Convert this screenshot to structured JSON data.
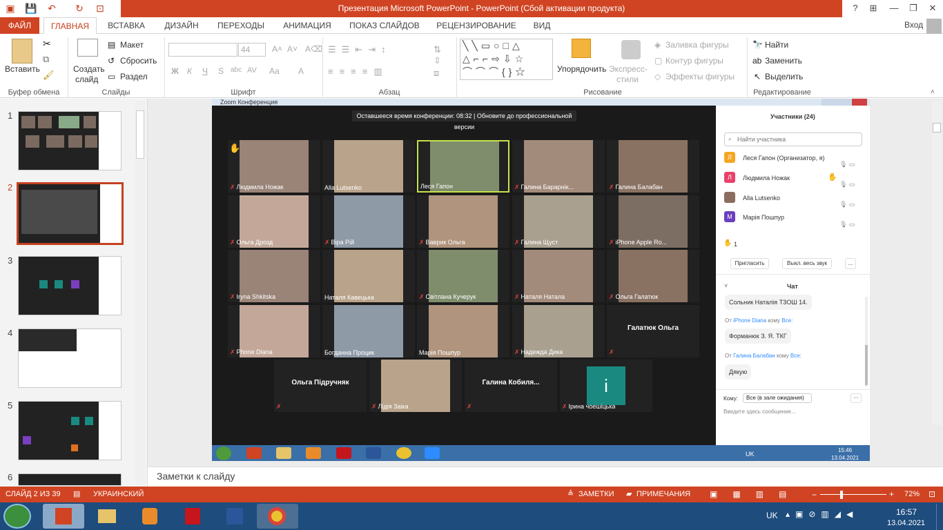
{
  "window": {
    "title": "Презентация Microsoft PowerPoint - PowerPoint (Сбой активации продукта)",
    "login": "Вход"
  },
  "tabs": [
    {
      "label": "ФАЙЛ"
    },
    {
      "label": "ГЛАВНАЯ"
    },
    {
      "label": "ВСТАВКА"
    },
    {
      "label": "ДИЗАЙН"
    },
    {
      "label": "ПЕРЕХОДЫ"
    },
    {
      "label": "АНИМАЦИЯ"
    },
    {
      "label": "ПОКАЗ СЛАЙДОВ"
    },
    {
      "label": "РЕЦЕНЗИРОВАНИЕ"
    },
    {
      "label": "ВИД"
    }
  ],
  "ribbon": {
    "clipboard": {
      "paste": "Вставить",
      "label": "Буфер обмена"
    },
    "slides": {
      "new_slide_1": "Создать",
      "new_slide_2": "слайд",
      "layout": "Макет",
      "reset": "Сбросить",
      "section": "Раздел",
      "label": "Слайды"
    },
    "font": {
      "size": "44",
      "bold": "Ж",
      "italic": "К",
      "underline": "Ч",
      "strike": "S",
      "label": "Шрифт"
    },
    "paragraph": {
      "label": "Абзац"
    },
    "drawing": {
      "arrange_1": "Упорядочить",
      "express_1": "Экспресс-",
      "express_2": "стили",
      "fill": "Заливка фигуры",
      "outline": "Контур фигуры",
      "effects": "Эффекты фигуры",
      "label": "Рисование"
    },
    "editing": {
      "find": "Найти",
      "replace": "Заменить",
      "select": "Выделить",
      "label": "Редактирование"
    }
  },
  "thumbs": [
    {
      "num": "1"
    },
    {
      "num": "2"
    },
    {
      "num": "3"
    },
    {
      "num": "4"
    },
    {
      "num": "5"
    },
    {
      "num": "6"
    }
  ],
  "zoom": {
    "window_title": "Zoom Конференция",
    "banner": "Оставшееся время конференции: 08:32 | Обновите до профессиональной версии",
    "tiles": [
      {
        "name": "Людмила Ножак",
        "mute": true,
        "hand": true
      },
      {
        "name": "Alla Lutsenko",
        "mute": false
      },
      {
        "name": "Леся Гапон",
        "mute": false,
        "active": true
      },
      {
        "name": "Галина Барарнік...",
        "mute": true
      },
      {
        "name": "Галина Балабан",
        "mute": true
      },
      {
        "name": "Ольга Дрозд",
        "mute": true
      },
      {
        "name": "Віра Рій",
        "mute": true
      },
      {
        "name": "Ваврик Ольга",
        "mute": true
      },
      {
        "name": "Галина Щуст",
        "mute": true
      },
      {
        "name": "iPhone Apple Ro...",
        "mute": true
      },
      {
        "name": "Iryna Shkitska",
        "mute": true
      },
      {
        "name": "Наталя Кавецька",
        "mute": false
      },
      {
        "name": "Світлана Кучерук",
        "mute": true
      },
      {
        "name": "Наталя Натала",
        "mute": true
      },
      {
        "name": "Ольга Галатюк",
        "mute": true
      },
      {
        "name": "Phone Diana",
        "mute": true
      },
      {
        "name": "Богданна Процик",
        "mute": false
      },
      {
        "name": "Марія Пошпур",
        "mute": false
      },
      {
        "name": "Надежда Дика",
        "mute": true
      },
      {
        "name": "",
        "big": "Галатюк Ольга",
        "mute": true,
        "nocam": true
      },
      {
        "name": "",
        "big": "Ольга Підручняк",
        "mute": true,
        "nocam": true
      },
      {
        "name": "Лідія Заіка",
        "mute": true
      },
      {
        "name": "",
        "big": "Галина  Кобиля...",
        "mute": true,
        "nocam": true
      },
      {
        "name": "Ірина чоешіцька",
        "mute": true,
        "letter": "i"
      }
    ],
    "participants": {
      "title": "Участники (24)",
      "search_placeholder": "Найти участника",
      "list": [
        {
          "letter": "Л",
          "name": "Леся Гапон (Организатор, я)",
          "color": "#f5a623"
        },
        {
          "letter": "Л",
          "name": "Людмила Ножак",
          "color": "#e8426a"
        },
        {
          "letter": "",
          "name": "Alla Lutsenko",
          "color": "#8a6d5e"
        },
        {
          "letter": "М",
          "name": "Марія Пошпур",
          "color": "#6b3fbf"
        }
      ],
      "hand_count": "1",
      "invite": "Пригласить",
      "mute_all": "Выкл. весь звук",
      "more": "..."
    },
    "chat": {
      "title": "Чат",
      "messages": [
        {
          "from": "",
          "text": "Сольник Наталія ТЗОШ 14."
        },
        {
          "from_pre": "От",
          "from": "iPhone Diana",
          "to_pre": "кому",
          "to": "Все:",
          "text": "Форманюк З. Я. ТКГ"
        },
        {
          "from_pre": "От",
          "from": "Галина Балабан",
          "to_pre": "кому",
          "to": "Все:",
          "text": "Дякую"
        }
      ],
      "to_label": "Кому:",
      "to_value": "Все (в зале ожидания)",
      "input_placeholder": "Введите здесь сообщение..."
    },
    "tray": {
      "lang": "UK",
      "time": "15:46",
      "date": "13.04.2021"
    }
  },
  "notes": "Заметки к слайду",
  "status": {
    "slide": "СЛАЙД 2 ИЗ 39",
    "lang": "УКРАИНСКИЙ",
    "notes": "ЗАМЕТКИ",
    "comments": "ПРИМЕЧАНИЯ",
    "zoom": "72%"
  },
  "taskbar": {
    "lang": "UK",
    "time": "16:57",
    "date": "13.04.2021"
  }
}
